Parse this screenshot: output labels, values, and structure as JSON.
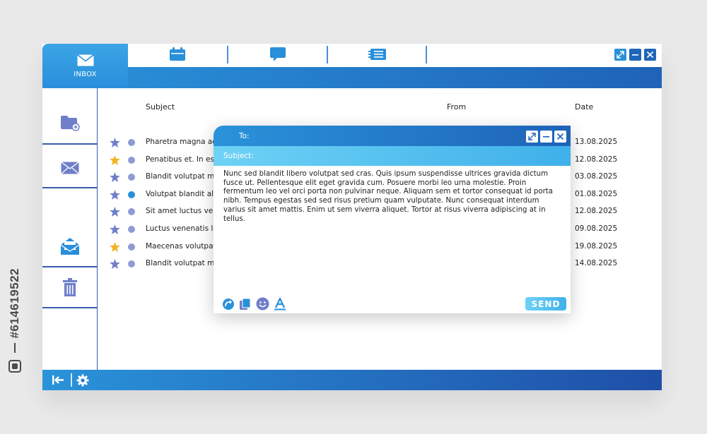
{
  "stock": {
    "id": "#614619522"
  },
  "header": {
    "inbox_label": "INBOX",
    "tabs": [
      {
        "icon": "calendar-icon"
      },
      {
        "icon": "chat-bubble-icon"
      },
      {
        "icon": "list-icon"
      }
    ],
    "window_controls": [
      "expand-icon",
      "minimize-icon",
      "close-icon"
    ]
  },
  "sidebar": {
    "items": [
      "folder-add-icon",
      "mail-icon",
      "mail-open-icon",
      "trash-icon"
    ]
  },
  "list": {
    "columns": {
      "subject": "Subject",
      "from": "From",
      "date": "Date"
    },
    "rows": [
      {
        "subject": "Pharetra magna ac",
        "date": "13.08.2025",
        "starred": false,
        "unread": false
      },
      {
        "subject": "Penatibus et. In est",
        "date": "12.08.2025",
        "starred": true,
        "unread": false
      },
      {
        "subject": "Blandit volutpat ma",
        "date": "03.08.2025",
        "starred": false,
        "unread": false
      },
      {
        "subject": "Volutpat blandit al",
        "date": "01.08.2025",
        "starred": false,
        "unread": true
      },
      {
        "subject": "Sit amet luctus ven",
        "date": "12.08.2025",
        "starred": false,
        "unread": false
      },
      {
        "subject": "Luctus venenatis le",
        "date": "09.08.2025",
        "starred": false,
        "unread": false
      },
      {
        "subject": "Maecenas volutpat",
        "date": "19.08.2025",
        "starred": true,
        "unread": false
      },
      {
        "subject": "Blandit volutpat ma",
        "date": "14.08.2025",
        "starred": false,
        "unread": false
      }
    ]
  },
  "compose": {
    "to_label": "To:",
    "subject_label": "Subject:",
    "body": "Nunc sed blandit libero volutpat sed cras. Quis ipsum suspendisse ultrices gravida dictum fusce ut. Pellentesque elit eget gravida cum. Posuere morbi leo urna molestie. Proin fermentum leo vel orci porta non pulvinar neque. Aliquam sem et tortor consequat id porta nibh. Tempus egestas sed sed risus pretium quam vulputate. Nunc consequat interdum varius sit amet mattis. Enim ut sem viverra aliquet. Tortor at risus viverra adipiscing at in tellus.",
    "send_label": "SEND",
    "tools": [
      "redo-icon",
      "copy-icon",
      "emoji-icon",
      "text-format-icon"
    ]
  },
  "footer": {
    "icons": [
      "collapse-sidebar-icon",
      "settings-gear-icon"
    ]
  },
  "colors": {
    "primary": "#2a8fdb",
    "primary_dark": "#1f4fa8",
    "light_accent": "#6ed2f5",
    "star_filled": "#f3b21c",
    "star_empty": "#6f7fc9",
    "dot": "#8e9bd4"
  }
}
